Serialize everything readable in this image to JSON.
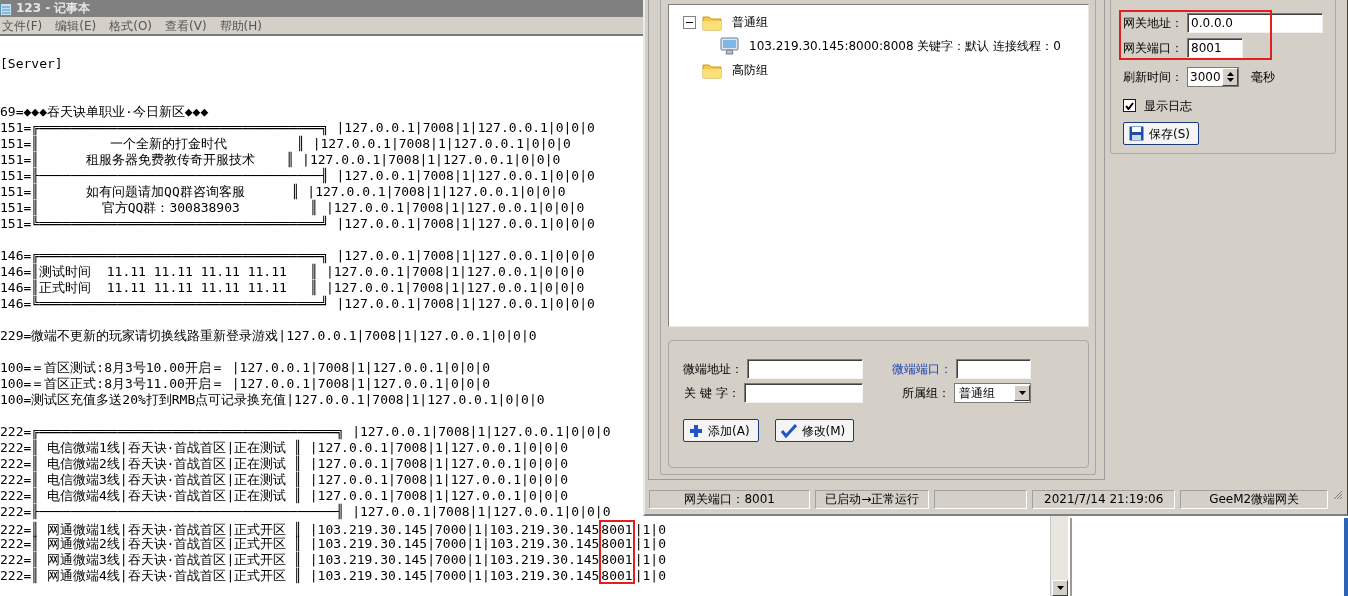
{
  "notepad": {
    "title": "123 - 记事本",
    "menu": [
      "文件(F)",
      "编辑(E)",
      "格式(O)",
      "查看(V)",
      "帮助(H)"
    ],
    "header": "[Server]",
    "blocks": [
      [
        {
          "text": "69=◆◆◆吞天诀单职业·今日新区◆◆◆"
        },
        {
          "text": "151=╔════════════════════════════════════╗ |127.0.0.1|7008|1|127.0.0.1|0|0|0"
        },
        {
          "text": "151=║         一个全新的打金时代         ║ |127.0.0.1|7008|1|127.0.0.1|0|0|0"
        },
        {
          "text": "151=║      租服务器免费教传奇开服技术    ║ |127.0.0.1|7008|1|127.0.0.1|0|0|0"
        },
        {
          "text": "151=╟────────────────────────────────────╢ |127.0.0.1|7008|1|127.0.0.1|0|0|0"
        },
        {
          "text": "151=║      如有问题请加QQ群咨询客服      ║ |127.0.0.1|7008|1|127.0.0.1|0|0|0"
        },
        {
          "text": "151=║        官方QQ群：300838903         ║ |127.0.0.1|7008|1|127.0.0.1|0|0|0"
        },
        {
          "text": "151=╚════════════════════════════════════╝ |127.0.0.1|7008|1|127.0.0.1|0|0|0"
        }
      ],
      [
        {
          "text": "146=╔════════════════════════════════════╗ |127.0.0.1|7008|1|127.0.0.1|0|0|0"
        },
        {
          "text": "146=║测试时间  11.11 11.11 11.11 11.11   ║ |127.0.0.1|7008|1|127.0.0.1|0|0|0"
        },
        {
          "text": "146=║正式时间  11.11 11.11 11.11 11.11   ║ |127.0.0.1|7008|1|127.0.0.1|0|0|0"
        },
        {
          "text": "146=╚════════════════════════════════════╝ |127.0.0.1|7008|1|127.0.0.1|0|0|0"
        }
      ],
      [
        {
          "text": "229=微端不更新的玩家请切换线路重新登录游戏|127.0.0.1|7008|1|127.0.0.1|0|0|0"
        }
      ],
      [
        {
          "text": "100=＝首区测试:8月3号10.00开启＝ |127.0.0.1|7008|1|127.0.0.1|0|0|0"
        },
        {
          "text": "100=＝首区正式:8月3号11.00开启＝ |127.0.0.1|7008|1|127.0.0.1|0|0|0"
        },
        {
          "text": "100=测试区充值多送20%打到RMB点可记录换充值|127.0.0.1|7008|1|127.0.0.1|0|0|0"
        }
      ],
      [
        {
          "text": "222=╔══════════════════════════════════════╗ |127.0.0.1|7008|1|127.0.0.1|0|0|0"
        },
        {
          "text": "222=║ 电信微端1线|吞天诀·首战首区|正在测试 ║ |127.0.0.1|7008|1|127.0.0.1|0|0|0"
        },
        {
          "text": "222=║ 电信微端2线|吞天诀·首战首区|正在测试 ║ |127.0.0.1|7008|1|127.0.0.1|0|0|0"
        },
        {
          "text": "222=║ 电信微端3线|吞天诀·首战首区|正在测试 ║ |127.0.0.1|7008|1|127.0.0.1|0|0|0"
        },
        {
          "text": "222=║ 电信微端4线|吞天诀·首战首区|正在测试 ║ |127.0.0.1|7008|1|127.0.0.1|0|0|0"
        },
        {
          "text": "222=╟──────────────────────────────────────╢ |127.0.0.1|7008|1|127.0.0.1|0|0|0"
        },
        {
          "text": "222=║ 网通微端1线|吞天诀·首战首区|正式开区 ║ |103.219.30.145|7000|1|103.219.30.145",
          "boxed": "8001",
          "rest": "|1|0"
        },
        {
          "text": "222=║ 网通微端2线|吞天诀·首战首区|正式开区 ║ |103.219.30.145|7000|1|103.219.30.145",
          "boxed": "8001",
          "rest": "|1|0"
        },
        {
          "text": "222=║ 网通微端3线|吞天诀·首战首区|正式开区 ║ |103.219.30.145|7000|1|103.219.30.145",
          "boxed": "8001",
          "rest": "|1|0"
        },
        {
          "text": "222=║ 网通微端4线|吞天诀·首战首区|正式开区 ║ |103.219.30.145|7000|1|103.219.30.145",
          "boxed": "8001",
          "rest": "|1|0"
        }
      ]
    ]
  },
  "gateway": {
    "tree": [
      {
        "label": "普通组",
        "kind": "group",
        "expanded": true,
        "children": [
          {
            "label": "103.219.30.145:8000:8008 关键字：默认 连接线程：0",
            "kind": "client"
          }
        ]
      },
      {
        "label": "高防组",
        "kind": "group"
      }
    ],
    "client_form": {
      "fields": [
        {
          "label": "微端地址：",
          "kind": "input",
          "emphasized": false
        },
        {
          "label": "微端端口：",
          "kind": "input",
          "emphasized": true
        },
        {
          "label": "关 键 字：",
          "kind": "input",
          "emphasized": false
        },
        {
          "label": "所属组：",
          "kind": "select",
          "value": "普通组",
          "emphasized": false
        }
      ],
      "buttons": [
        {
          "label": "添加(A)"
        },
        {
          "label": "修改(M)"
        }
      ]
    },
    "settings": {
      "fields": [
        {
          "label": "网关地址：",
          "value": "0.0.0.0",
          "marked": true
        },
        {
          "label": "网关端口：",
          "value": "8001",
          "marked": true
        }
      ],
      "refresh": {
        "label": "刷新时间：",
        "value": "3000",
        "unit": "毫秒"
      },
      "show_log": {
        "label": "显示日志",
        "checked": true
      },
      "save_button": {
        "label": "保存(S)"
      }
    },
    "status_bar": [
      {
        "kind": "text",
        "text": "网关端口：8001"
      },
      {
        "kind": "text",
        "text": "已启动→正常运行"
      },
      {
        "kind": "blank"
      },
      {
        "kind": "text",
        "text": "2021/7/14 21:19:06"
      },
      {
        "kind": "text",
        "text": "GeeM2微端网关"
      }
    ]
  }
}
